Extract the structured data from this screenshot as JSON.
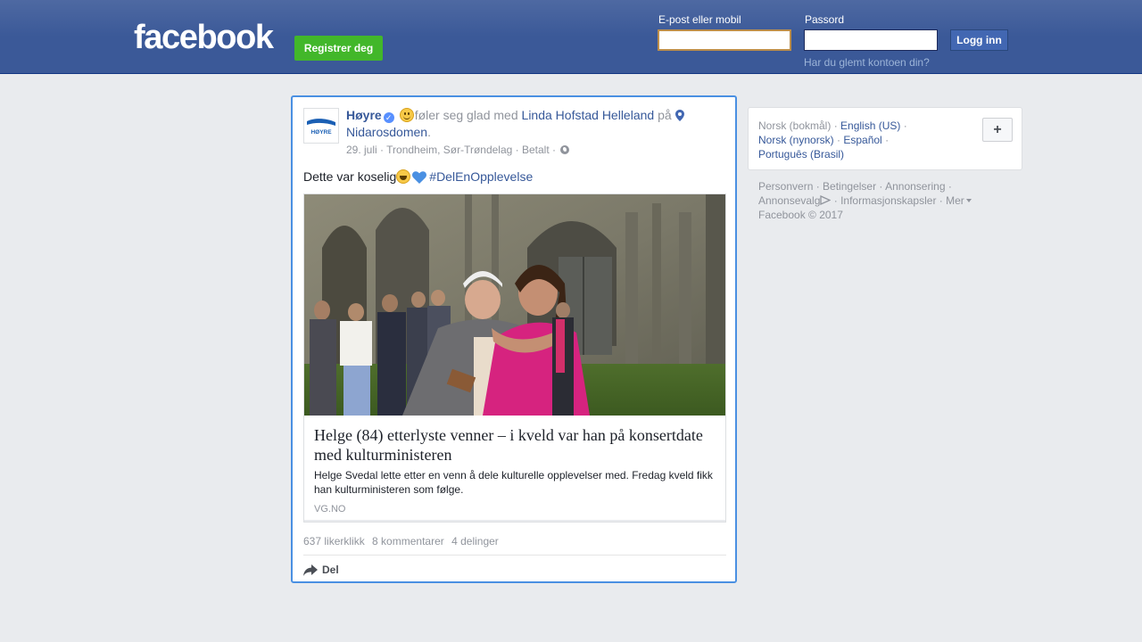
{
  "header": {
    "logo": "facebook",
    "register_label": "Registrer deg",
    "email_label": "E-post eller mobil",
    "email_value": "",
    "password_label": "Passord",
    "password_value": "",
    "login_label": "Logg inn",
    "forgot_label": "Har du glemt kontoen din?"
  },
  "post": {
    "page_name": "Høyre",
    "avatar_text": "HØYRE",
    "feeling_text": "føler seg glad med",
    "tagged_person": "Linda Hofstad Helleland",
    "location_prefix": "på",
    "location": "Nidarosdomen",
    "period": ".",
    "date": "29. juli",
    "place": "Trondheim, Sør-Trøndelag",
    "sponsored": "Betalt",
    "separator": "·",
    "text": "Dette var koselig",
    "hashtag": "#DelEnOpplevelse",
    "link": {
      "title": "Helge (84) etterlyste venner – i kveld var han på konsertdate med kulturministeren",
      "description": "Helge Svedal lette etter en venn å dele kulturelle opplevelser med. Fredag kveld fikk han kulturministeren som følge.",
      "domain": "VG.NO"
    },
    "likes": "637 likerklikk",
    "comments": "8 kommentarer",
    "shares": "4 delinger",
    "share_action": "Del"
  },
  "languages": {
    "current": "Norsk (bokmål)",
    "options": [
      "English (US)",
      "Norsk (nynorsk)",
      "Español",
      "Português (Brasil)"
    ],
    "more_symbol": "+"
  },
  "footer": {
    "privacy": "Personvern",
    "terms": "Betingelser",
    "advertising": "Annonsering",
    "ad_choices": "Annonsevalg",
    "cookies": "Informasjonskapsler",
    "more": "Mer",
    "copyright": "Facebook © 2017"
  },
  "colors": {
    "brand": "#3b5998",
    "register_green": "#42b72a",
    "link": "#365899",
    "focus_border": "#4a90e2"
  }
}
